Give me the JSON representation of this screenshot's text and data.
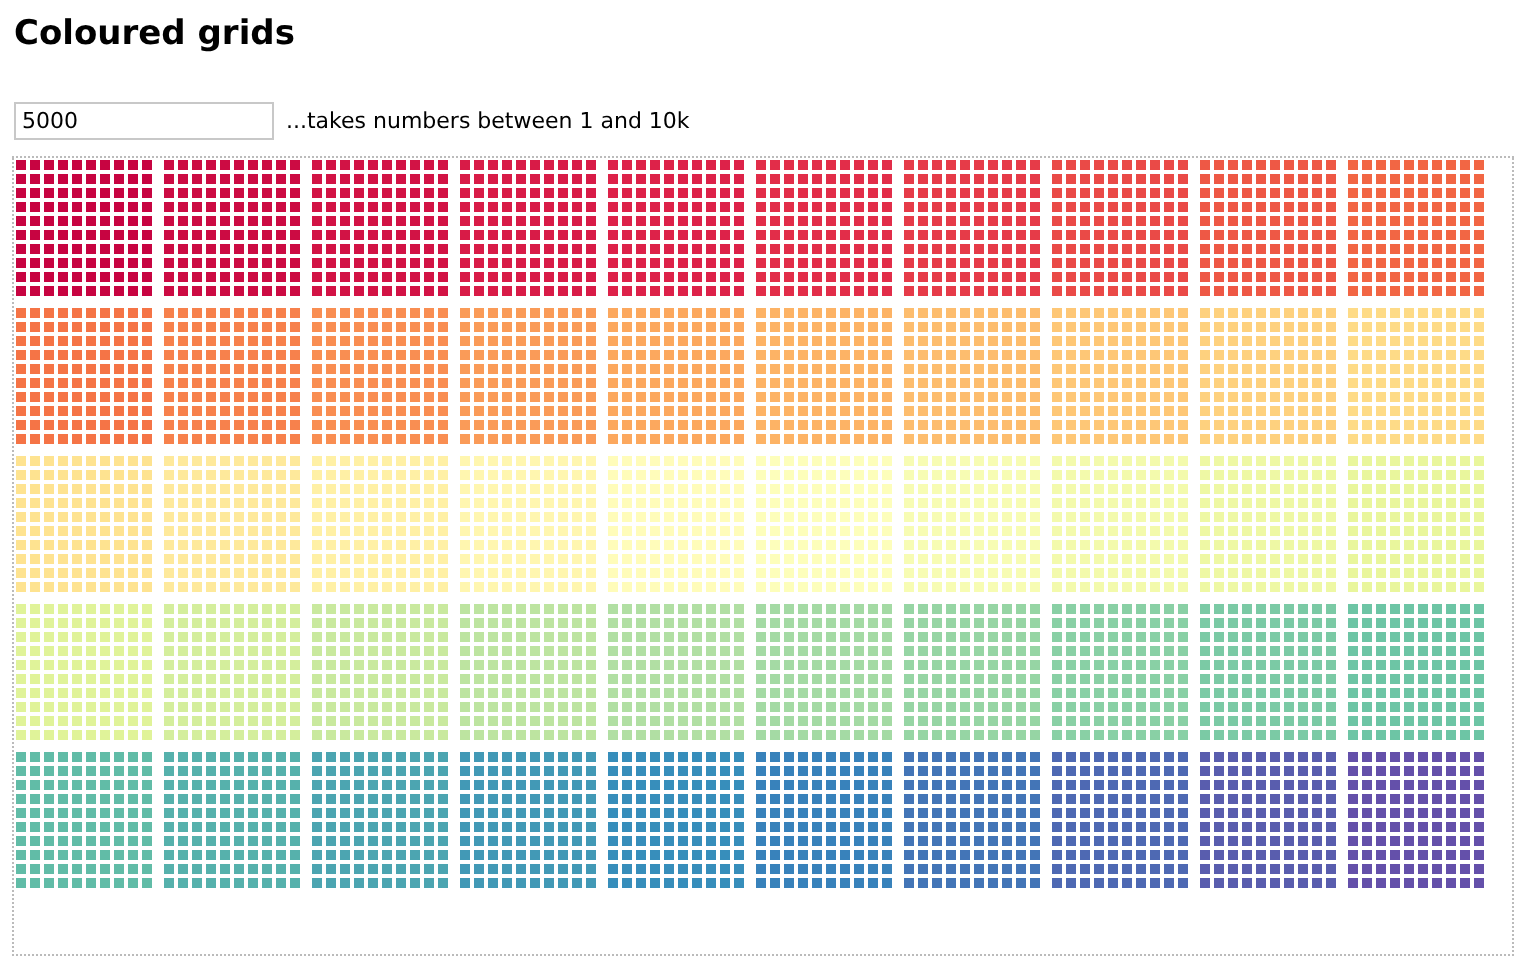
{
  "title": "Coloured grids",
  "count_field": {
    "value": "5000",
    "hint": "...takes numbers between 1 and 10k"
  }
}
